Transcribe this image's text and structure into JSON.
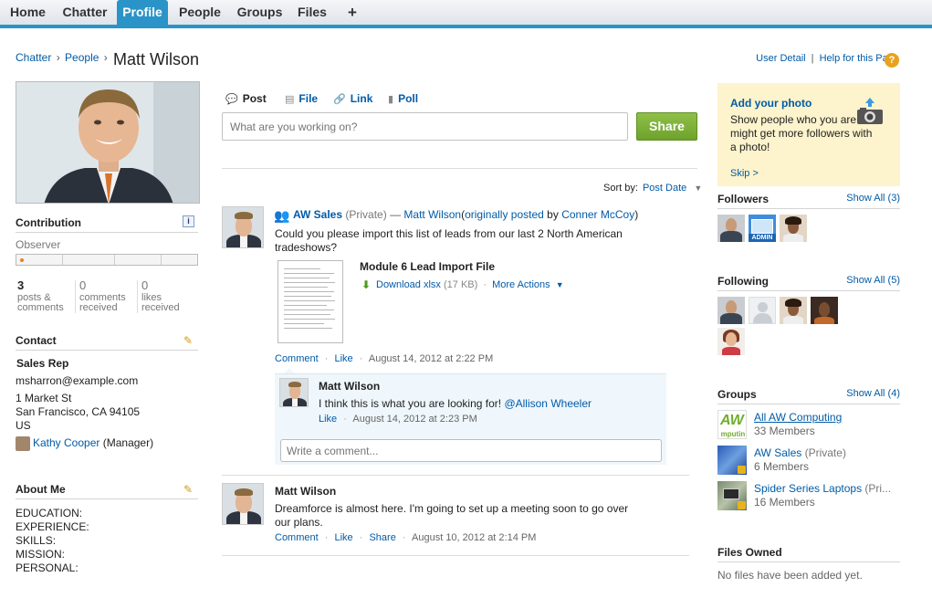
{
  "nav": {
    "tabs": [
      {
        "label": "Home"
      },
      {
        "label": "Chatter"
      },
      {
        "label": "Profile",
        "active": true
      },
      {
        "label": "People"
      },
      {
        "label": "Groups"
      },
      {
        "label": "Files"
      },
      {
        "label": "+"
      }
    ]
  },
  "breadcrumb": {
    "items": [
      "Chatter",
      "People"
    ],
    "separator": "›",
    "title": "Matt Wilson"
  },
  "top_links": {
    "user_detail": "User Detail",
    "separator": "|",
    "help": "Help for this Page",
    "help_icon": "?"
  },
  "profile": {
    "contribution": {
      "heading": "Contribution",
      "info_icon": "i",
      "level": "Observer",
      "level_progress": 0.02,
      "stats": [
        {
          "num": "3",
          "label1": "posts &",
          "label2": "comments"
        },
        {
          "num": "0",
          "label1": "comments",
          "label2": "received"
        },
        {
          "num": "0",
          "label1": "likes",
          "label2": "received"
        }
      ]
    },
    "contact": {
      "heading": "Contact",
      "role": "Sales Rep",
      "email": "msharron@example.com",
      "address1": "1 Market St",
      "address2": "San Francisco, CA 94105",
      "country": "US",
      "manager_name": "Kathy Cooper",
      "manager_label": "(Manager)"
    },
    "about": {
      "heading": "About Me",
      "lines": [
        "EDUCATION:",
        "EXPERIENCE:",
        "SKILLS:",
        "MISSION:",
        "PERSONAL:"
      ]
    }
  },
  "publisher": {
    "tabs": [
      {
        "label": "Post",
        "icon": "speech-bubble-icon"
      },
      {
        "label": "File",
        "icon": "document-icon"
      },
      {
        "label": "Link",
        "icon": "link-icon"
      },
      {
        "label": "Poll",
        "icon": "bar-chart-icon"
      }
    ],
    "placeholder": "What are you working on?",
    "share_label": "Share"
  },
  "sort": {
    "label": "Sort by:",
    "value": "Post Date",
    "caret": "▼"
  },
  "feed": {
    "post1": {
      "group": "AW Sales",
      "privacy": "(Private)",
      "dash": "—",
      "author": "Matt Wilson",
      "orig_open": "(",
      "orig_link": "originally posted",
      "orig_by": "by",
      "orig_author": "Conner McCoy",
      "orig_close": ")",
      "text1": "Could you please import this list of leads from our last 2 North American",
      "text2": "tradeshows?",
      "file_title": "Module 6 Lead Import File",
      "download": "Download xlsx",
      "size": "(17 KB)",
      "more_actions": "More Actions",
      "more_caret": "▼",
      "actions": [
        "Comment",
        "Like"
      ],
      "timestamp": "August 14, 2012 at 2:22 PM",
      "comment": {
        "author": "Matt Wilson",
        "text": "I think this is what you are looking for!",
        "mention": "@Allison Wheeler",
        "action": "Like",
        "timestamp": "August 14, 2012 at 2:23 PM"
      },
      "comment_placeholder": "Write a comment..."
    },
    "post2": {
      "author": "Matt Wilson",
      "text1": "Dreamforce is almost here. I'm going to set up a meeting soon to go over",
      "text2": "our plans.",
      "actions": [
        "Comment",
        "Like",
        "Share"
      ],
      "timestamp": "August 10, 2012 at 2:14 PM"
    },
    "dot": "·"
  },
  "sidebar": {
    "photo_card": {
      "title": "Add your photo",
      "body": "Show people who you are. You might get more followers with a photo!",
      "skip": "Skip >"
    },
    "followers": {
      "heading": "Followers",
      "show_all": "Show All (3)"
    },
    "following": {
      "heading": "Following",
      "show_all": "Show All (5)"
    },
    "groups": {
      "heading": "Groups",
      "show_all": "Show All (4)",
      "items": [
        {
          "name": "All AW Computing",
          "sub": "33 Members",
          "icon_text": "AW\nmputin"
        },
        {
          "name": "AW Sales",
          "privacy": "(Private)",
          "sub": "6 Members"
        },
        {
          "name": "Spider Series Laptops",
          "privacy": "(Pri...",
          "sub": "16 Members"
        }
      ]
    },
    "files": {
      "heading": "Files Owned",
      "empty": "No files have been added yet."
    },
    "admin_badge": "ADMIN"
  },
  "colors": {
    "accent": "#2a94c8",
    "link": "#015ba7",
    "share_green": "#7ab03a",
    "card_yellow": "#fdf3cc"
  }
}
